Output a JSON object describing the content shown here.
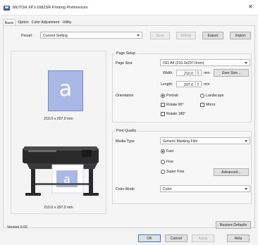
{
  "window": {
    "title": "MUTOH XPJ-1682SR Printing Preferences",
    "close_glyph": "✕"
  },
  "tabs": [
    {
      "label": "Basic"
    },
    {
      "label": "Option"
    },
    {
      "label": "Color Adjustment"
    },
    {
      "label": "Utility"
    }
  ],
  "preset": {
    "label": "Preset :",
    "value": "Current Setting",
    "buttons": {
      "save": "Save",
      "delete": "Delete",
      "export": "Export",
      "import": "Import"
    }
  },
  "preview": {
    "paper_letter": "a",
    "paper_size_text": "210.0 x 297.0 mm",
    "printer_size_text": "210.0 x 297.0 mm"
  },
  "page_setup": {
    "title": "Page Setup",
    "page_size_label": "Page Size",
    "page_size_value": "ISO A4 (210.0x297.0mm)",
    "width_label": "Width:",
    "width_value": "210.0",
    "height_label": "Length:",
    "height_value": "297.0",
    "unit": "mm",
    "user_size_button": "User Size...",
    "orientation_label": "Orientation",
    "portrait": "Portrait",
    "landscape": "Landscape",
    "rotate90": "Rotate 90°",
    "mirror": "Mirror",
    "rotate180": "Rotate 180°"
  },
  "print_quality": {
    "title": "Print Quality",
    "media_type_label": "Media Type",
    "media_type_value": "Generic Marking Film",
    "fast": "Fast",
    "fine": "Fine",
    "super_fine": "Super Fine",
    "advanced_button": "Advanced...",
    "color_mode_label": "Color Mode",
    "color_mode_value": "Color"
  },
  "footer": {
    "version": "Version 0.02",
    "restore_defaults": "Restore Defaults",
    "ok": "OK",
    "cancel": "Cancel",
    "apply": "Apply",
    "help": "Help"
  },
  "colors": {
    "accent": "#2f7bd6",
    "paper_fill": "#a9b8e4"
  },
  "icons": [
    "printer-app-icon",
    "close-icon",
    "chevron-down-icon",
    "spin-updown-icon",
    "printer-image"
  ]
}
